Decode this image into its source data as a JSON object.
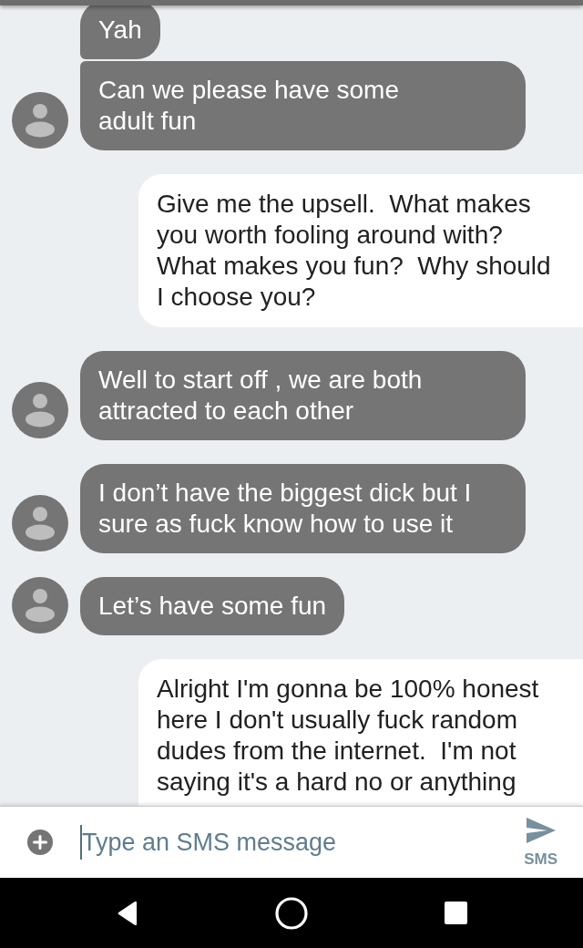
{
  "messages": [
    {
      "kind": "incoming",
      "avatar": false,
      "lines": [
        "Yah"
      ]
    },
    {
      "kind": "incoming",
      "avatar": true,
      "lines": [
        "Can we please have some",
        "adult fun"
      ]
    },
    {
      "kind": "outgoing",
      "lines": [
        "Give me the upsell.  What makes",
        "you worth fooling around with?",
        "What makes you fun?  Why should",
        "I choose you?"
      ]
    },
    {
      "kind": "incoming",
      "avatar": true,
      "lines": [
        "Well to start off , we are both",
        "attracted to each other"
      ]
    },
    {
      "kind": "incoming",
      "avatar": true,
      "lines": [
        "I don’t have the biggest dick but I",
        "sure as fuck know how to use it"
      ]
    },
    {
      "kind": "incoming",
      "avatar": true,
      "lines": [
        "Let’s have some fun"
      ]
    },
    {
      "kind": "outgoing",
      "lines": [
        "Alright I'm gonna be 100% honest",
        "here I don't usually fuck random",
        "dudes from the internet.  I'm not",
        "saying it's a hard no or anything"
      ]
    }
  ],
  "composer": {
    "placeholder": "Type an SMS message",
    "send_label": "SMS"
  }
}
